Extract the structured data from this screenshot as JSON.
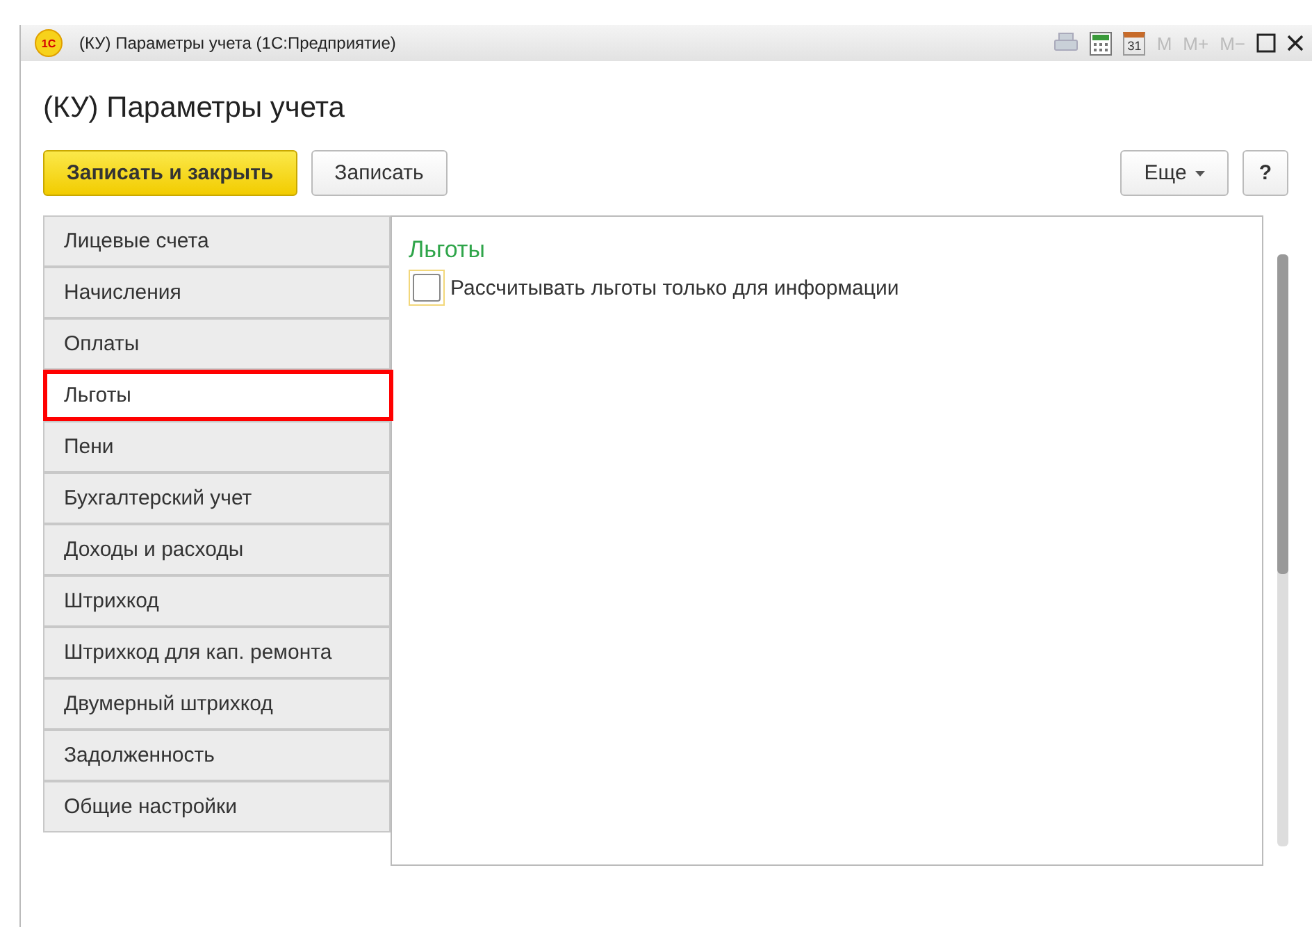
{
  "window": {
    "title": "(КУ) Параметры учета  (1С:Предприятие)",
    "logo": "1С",
    "calendar_day": "31",
    "memory_buttons": [
      "M",
      "M+",
      "M−"
    ]
  },
  "form": {
    "title": "(КУ) Параметры учета"
  },
  "toolbar": {
    "primary": "Записать и закрыть",
    "secondary": "Записать",
    "more": "Еще",
    "help": "?"
  },
  "tabs": [
    {
      "label": "Лицевые счета",
      "selected": false
    },
    {
      "label": "Начисления",
      "selected": false
    },
    {
      "label": "Оплаты",
      "selected": false
    },
    {
      "label": "Льготы",
      "selected": true
    },
    {
      "label": "Пени",
      "selected": false
    },
    {
      "label": "Бухгалтерский учет",
      "selected": false
    },
    {
      "label": "Доходы и расходы",
      "selected": false
    },
    {
      "label": "Штрихкод",
      "selected": false
    },
    {
      "label": "Штрихкод для кап. ремонта",
      "selected": false
    },
    {
      "label": "Двумерный штрихкод",
      "selected": false
    },
    {
      "label": "Задолженность",
      "selected": false
    },
    {
      "label": "Общие настройки",
      "selected": false
    }
  ],
  "panel": {
    "title": "Льготы",
    "checkbox": {
      "label": "Рассчитывать льготы только для информации",
      "checked": false
    }
  }
}
